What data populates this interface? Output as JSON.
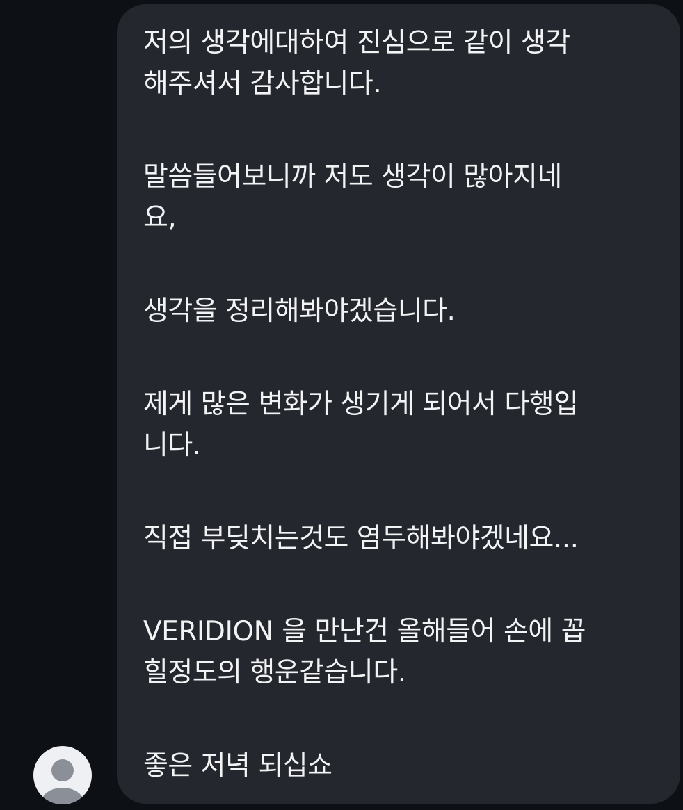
{
  "conversation": {
    "message": {
      "paragraphs": [
        "저의 생각에대하여 진심으로 같이 생각\n해주셔서 감사합니다.",
        "말씀들어보니까 저도 생각이 많아지네\n요,",
        "생각을 정리해봐야겠습니다.",
        "제게 많은 변화가 생기게 되어서 다행입\n니다.",
        "직접 부딪치는것도 염두해봐야겠네요...",
        "VERIDION 을 만난건 올해들어 손에 꼽\n힐정도의 행운같습니다.",
        "좋은 저녁 되십쇼"
      ]
    },
    "sender": {
      "avatar_icon": "default-user-avatar-icon"
    }
  },
  "colors": {
    "background": "#0d1116",
    "bubble": "#24272d",
    "text": "#f2f3f5",
    "avatar_bg": "#eef0f3",
    "avatar_figure": "#8a8f98"
  }
}
